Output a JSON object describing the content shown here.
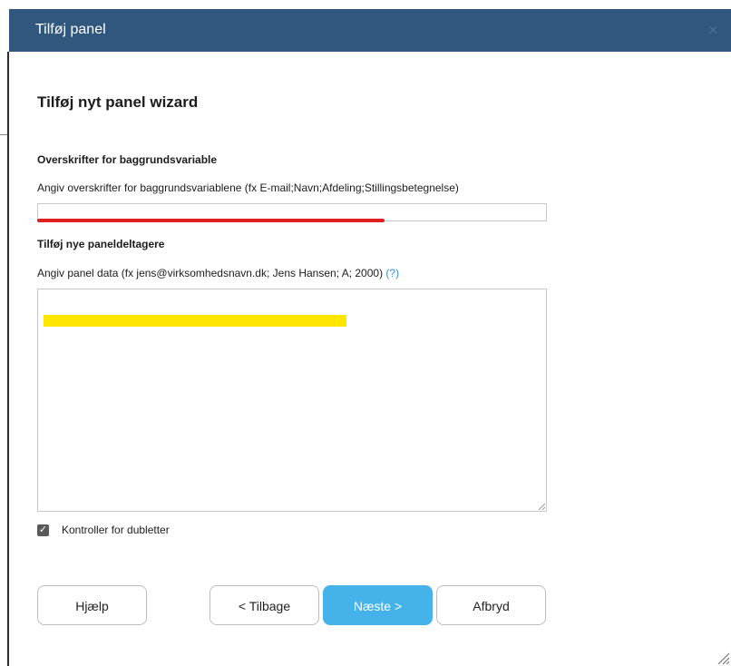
{
  "dialog": {
    "title": "Tilføj panel",
    "close_glyph": "×"
  },
  "wizard": {
    "heading": "Tilføj nyt panel wizard",
    "background_section": {
      "label": "Overskrifter for baggrundsvariable",
      "hint": "Angiv overskrifter for baggrundsvariablene (fx E-mail;Navn;Afdeling;Stillingsbetegnelse)",
      "value": ""
    },
    "participants_section": {
      "label": "Tilføj nye paneldeltagere",
      "hint": "Angiv panel data (fx jens@virksomhedsnavn.dk; Jens Hansen; A; 2000)",
      "help_link": "(?)",
      "value": ""
    },
    "duplicate_check": {
      "label": "Kontroller for dubletter",
      "checked": true
    }
  },
  "buttons": {
    "help": "Hjælp",
    "back": "< Tilbage",
    "next": "Næste >",
    "cancel": "Afbryd"
  },
  "colors": {
    "titlebar": "#31577f",
    "primary_button": "#45b3ea",
    "red_annotation": "#e02020",
    "yellow_highlight": "#ffe600"
  }
}
